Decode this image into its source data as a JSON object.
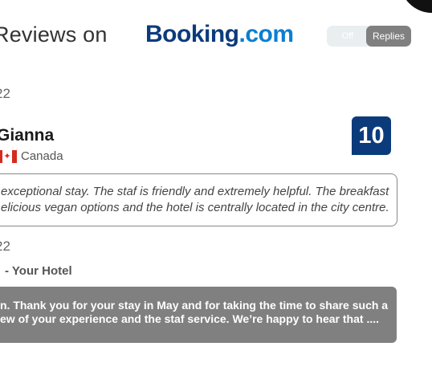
{
  "header": {
    "title": "Reviews on",
    "logo_part1": "Booking",
    "logo_part2": ".com"
  },
  "toggle": {
    "off_label": "Off",
    "on_label": "Replies"
  },
  "review": {
    "date": "22",
    "reviewer_name": "Gianna",
    "country": "Canada",
    "score": "10",
    "text_line1": "exceptional stay. The staf  is friendly and extremely helpful. The breakfast",
    "text_line2": "elicious vegan options and  the hotel is centrally located in the city centre."
  },
  "reply": {
    "date": "22",
    "from": "- Your Hotel",
    "text_line1": "n. Thank you for your stay in May and for taking the time to share such a",
    "text_line2": "ew of your experience and the staf  service. We’re happy to hear that ...."
  },
  "colors": {
    "booking_dark_blue": "#0c3b7c",
    "booking_light_blue": "#0b7fd1",
    "reply_bg": "#808080"
  }
}
